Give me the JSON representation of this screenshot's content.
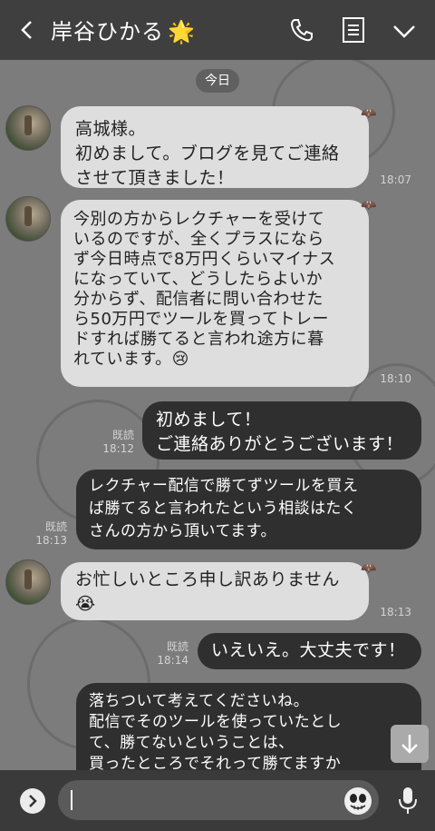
{
  "header": {
    "title": "岸谷ひかる",
    "title_emoji": "🌟"
  },
  "date_label": "今日",
  "messages": [
    {
      "text": "高城様。\n初めまして。ブログを見てご連絡\nさせて頂きました！",
      "time": "18:07"
    },
    {
      "text": "今別の方からレクチャーを受けて\nいるのですが、全くプラスになら\nず今日時点で8万円くらいマイナス\nになっていて、どうしたらよいか\n分からず、配信者に問い合わせた\nら50万円でツールを買ってトレー\nドすれば勝てると言われ途方に暮\nれています。😢",
      "time": "18:10"
    },
    {
      "text": "初めまして！\nご連絡ありがとうございます！",
      "read": "既読",
      "time": "18:12"
    },
    {
      "text": "レクチャー配信で勝てずツールを買え\nば勝てると言われたという相談はたく\nさんの方から頂いてます。",
      "read": "既読",
      "time": "18:13"
    },
    {
      "text": "お忙しいところ申し訳ありません\n😭",
      "time": "18:13"
    },
    {
      "text": "いえいえ。大丈夫です！",
      "read": "既読",
      "time": "18:14"
    },
    {
      "text": "落ちついて考えてくださいね。\n配信でそのツールを使っていたとし\nて、勝てないということは、\n買ったところでそれって勝てますか"
    }
  ],
  "input": {
    "value": ""
  },
  "colors": {
    "header_bg": "#3f3f3f",
    "incoming_bubble": "#dedede",
    "outgoing_bubble": "#2f2f2f",
    "chat_bg": "#7c7c7c"
  },
  "icons": [
    "back-icon",
    "call-icon",
    "notes-icon",
    "chevron-down-icon",
    "bat-icon",
    "scroll-down-icon",
    "expand-icon",
    "emoji-icon",
    "mic-icon"
  ]
}
